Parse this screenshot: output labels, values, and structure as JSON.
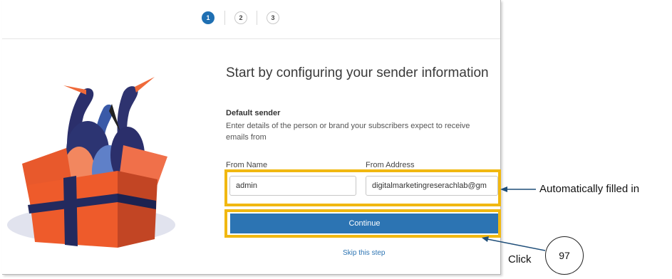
{
  "stepper": {
    "steps": [
      "1",
      "2",
      "3"
    ],
    "active_step": 1
  },
  "main": {
    "title": "Start by configuring your sender information",
    "section_label": "Default sender",
    "description": "Enter details of the person or brand your subscribers expect to receive emails from",
    "from_name_label": "From Name",
    "from_name_value": "admin",
    "from_address_label": "From Address",
    "from_address_value": "digitalmarketingreserachlab@gm",
    "continue_label": "Continue",
    "skip_label": "Skip this step"
  },
  "annotations": {
    "fields_note": "Automatically filled in",
    "click_note": "Click",
    "step_number": "97",
    "highlight_color": "#f1b811"
  },
  "colors": {
    "accent": "#2c74b3",
    "active_step": "#1f6fb2"
  },
  "icons": {
    "illustration": "birds-in-gift-box-illustration"
  }
}
